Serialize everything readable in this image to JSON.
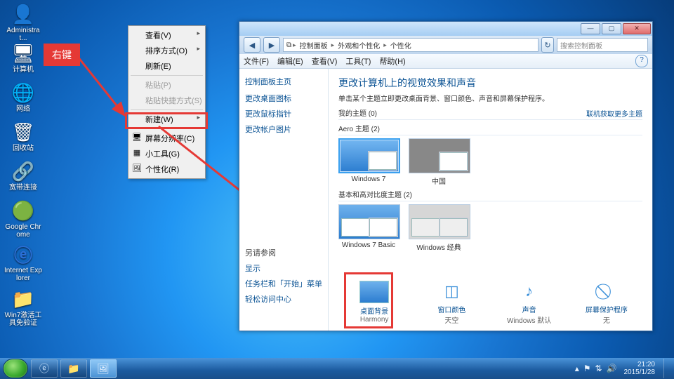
{
  "annotation": {
    "label": "右键"
  },
  "desktop": {
    "icons": [
      {
        "name": "admin",
        "label": "Administrat...",
        "glyph": "👤"
      },
      {
        "name": "computer",
        "label": "计算机",
        "glyph": "🖥"
      },
      {
        "name": "network",
        "label": "网络",
        "glyph": "🌐"
      },
      {
        "name": "recycle",
        "label": "回收站",
        "glyph": "🗑"
      },
      {
        "name": "broadband",
        "label": "宽带连接",
        "glyph": "🔗"
      },
      {
        "name": "chrome",
        "label": "Google Chrome",
        "glyph": "🟢"
      },
      {
        "name": "ie",
        "label": "Internet Explorer",
        "glyph": "ⓔ"
      },
      {
        "name": "win7tool",
        "label": "Win7激活工具免验证",
        "glyph": "📁"
      }
    ]
  },
  "contextMenu": {
    "items": [
      {
        "label": "查看(V)",
        "sub": true
      },
      {
        "label": "排序方式(O)",
        "sub": true
      },
      {
        "label": "刷新(E)"
      },
      {
        "sep": true
      },
      {
        "label": "粘贴(P)",
        "disabled": true
      },
      {
        "label": "粘贴快捷方式(S)",
        "disabled": true
      },
      {
        "sep": true
      },
      {
        "label": "新建(W)",
        "sub": true
      },
      {
        "sep": true
      },
      {
        "label": "屏幕分辨率(C)",
        "icon": "🖥"
      },
      {
        "label": "小工具(G)",
        "icon": "▦"
      },
      {
        "label": "个性化(R)",
        "icon": "🖼"
      }
    ]
  },
  "window": {
    "nav": {
      "back": "◀",
      "fwd": "▶"
    },
    "crumb": [
      "控制面板",
      "外观和个性化",
      "个性化"
    ],
    "searchPlaceholder": "搜索控制面板",
    "menubar": [
      "文件(F)",
      "编辑(E)",
      "查看(V)",
      "工具(T)",
      "帮助(H)"
    ],
    "left": {
      "home": "控制面板主页",
      "links": [
        "更改桌面图标",
        "更改鼠标指针",
        "更改帐户图片"
      ],
      "seeAlsoTitle": "另请参阅",
      "seeAlso": [
        "显示",
        "任务栏和「开始」菜单",
        "轻松访问中心"
      ]
    },
    "main": {
      "title": "更改计算机上的视觉效果和声音",
      "subtitle": "单击某个主题立即更改桌面背景、窗口颜色、声音和屏幕保护程序。",
      "moreThemes": "联机获取更多主题",
      "groups": {
        "my": "我的主题 (0)",
        "aero": "Aero 主题 (2)",
        "basic": "基本和高对比度主题 (2)"
      },
      "themes": {
        "win7": "Windows 7",
        "china": "中国",
        "basic": "Windows 7 Basic",
        "classic": "Windows 经典"
      },
      "settings": [
        {
          "key": "bg",
          "t1": "桌面背景",
          "t2": "Harmony",
          "glyph": "🖼"
        },
        {
          "key": "color",
          "t1": "窗口颜色",
          "t2": "天空",
          "glyph": "◫"
        },
        {
          "key": "sound",
          "t1": "声音",
          "t2": "Windows 默认",
          "glyph": "♪"
        },
        {
          "key": "saver",
          "t1": "屏幕保护程序",
          "t2": "无",
          "glyph": "⃠"
        }
      ]
    }
  },
  "taskbar": {
    "tray": {
      "time": "21:20",
      "date": "2015/1/28"
    }
  }
}
